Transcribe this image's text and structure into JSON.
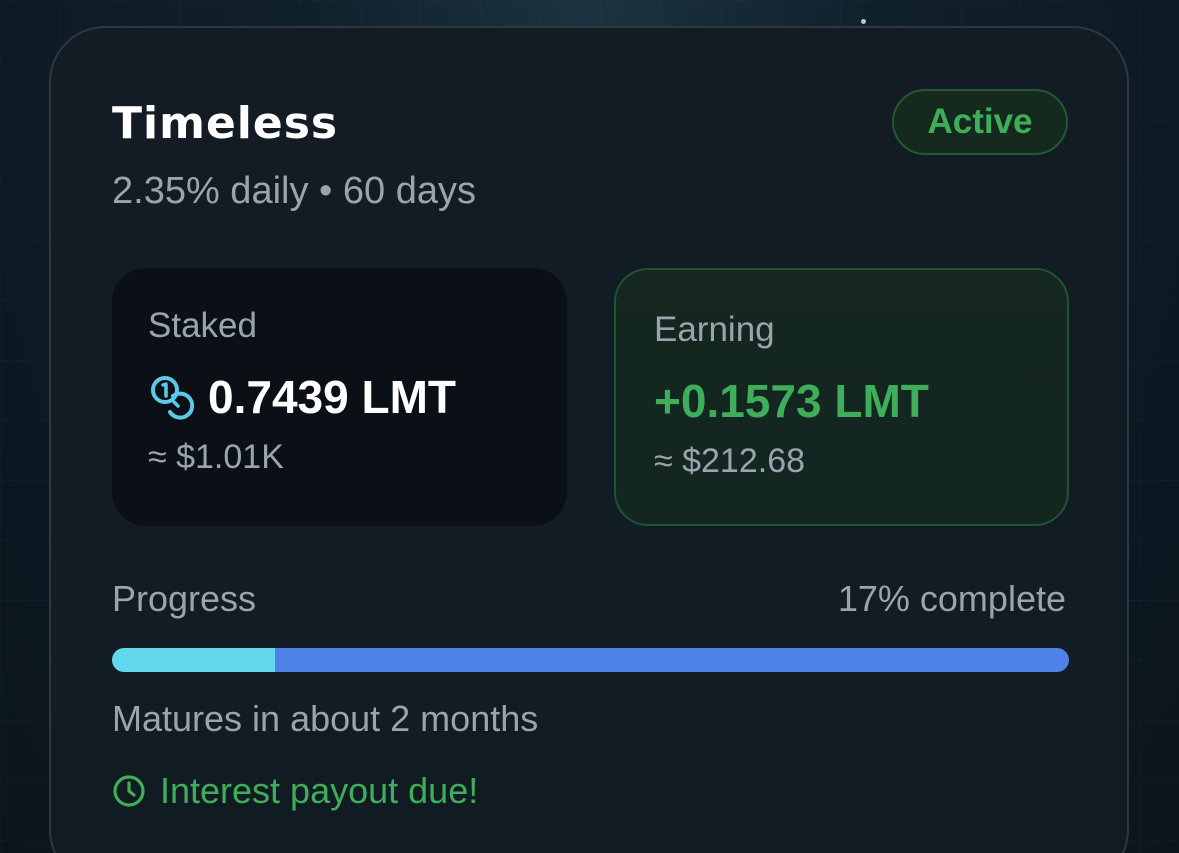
{
  "plan": {
    "title": "Timeless",
    "subtitle": "2.35% daily • 60 days",
    "status": "Active"
  },
  "staked": {
    "label": "Staked",
    "value": "0.7439 LMT",
    "usd": "≈ $1.01K",
    "icon": "coins-icon"
  },
  "earning": {
    "label": "Earning",
    "value": "+0.1573 LMT",
    "usd": "≈ $212.68"
  },
  "progress": {
    "label": "Progress",
    "percent_text": "17% complete",
    "fraction": 0.17
  },
  "matures_text": "Matures in about 2 months",
  "payout": {
    "text": "Interest payout due!",
    "icon": "clock-icon"
  },
  "colors": {
    "accent_green": "#3fae5b",
    "progress_fill": "#62d8ee",
    "progress_track": "#4f82e8",
    "coin_icon": "#5cc8ea"
  }
}
